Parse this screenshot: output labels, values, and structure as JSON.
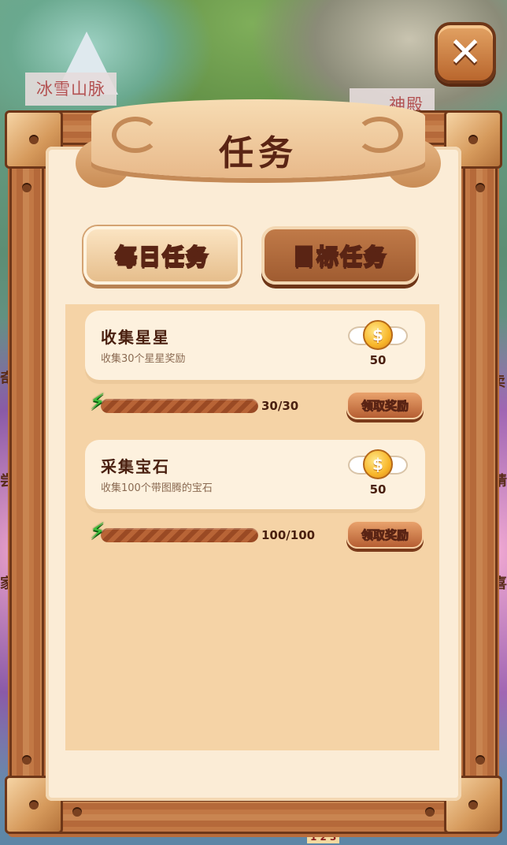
{
  "map": {
    "labels": [
      "冰雪山脉",
      "神殿"
    ],
    "pager": "1 2 3",
    "side_text": [
      "奇",
      "卖",
      "尝",
      "猜",
      "家",
      "喜"
    ]
  },
  "close_icon": "✕",
  "title": "任务",
  "tabs": [
    {
      "label": "每日任务",
      "state": "inactive"
    },
    {
      "label": "目标任务",
      "state": "active"
    }
  ],
  "tasks": [
    {
      "title": "收集星星",
      "desc": "收集30个星星奖励",
      "reward": "50",
      "progress_text": "30/30",
      "progress": 1.0,
      "claim_label": "领取奖励"
    },
    {
      "title": "采集宝石",
      "desc": "收集100个带图腾的宝石",
      "reward": "50",
      "progress_text": "100/100",
      "progress": 1.0,
      "claim_label": "领取奖励"
    }
  ],
  "icons": {
    "coin": "coin-icon",
    "bolt": "lightning-icon",
    "close": "close-icon"
  },
  "colors": {
    "frame_wood": "#b86d3c",
    "parchment": "#fbecd6",
    "panel": "#f5d3a6",
    "title_text": "#5a2414",
    "bolt_green": "#3cbf3a",
    "coin_gold": "#f8b62a"
  }
}
